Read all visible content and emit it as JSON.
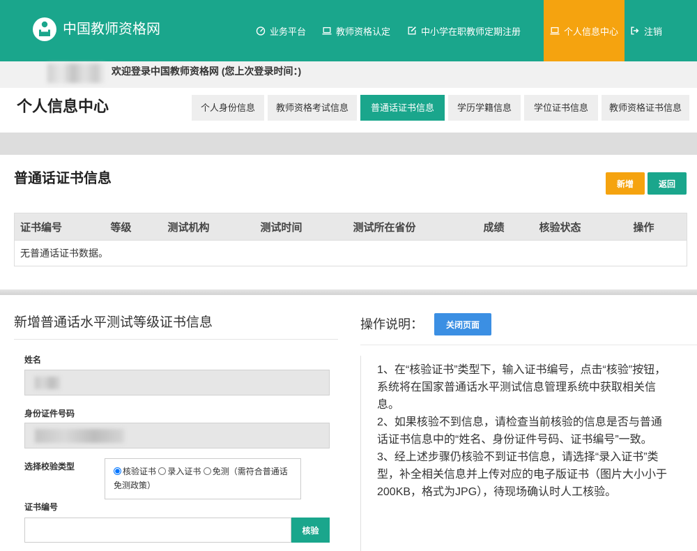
{
  "colors": {
    "primary": "#1aa68c",
    "accent": "#f5a30f",
    "info": "#3b8fe3"
  },
  "header": {
    "logo_icon": "teacher-logo-icon",
    "site_title": "中国教师资格网",
    "nav": [
      {
        "label": "业务平台",
        "icon": "dashboard-icon",
        "active": false
      },
      {
        "label": "教师资格认定",
        "icon": "monitor-icon",
        "active": false
      },
      {
        "label": "中小学在职教师定期注册",
        "icon": "edit-icon",
        "active": false
      },
      {
        "label": "个人信息中心",
        "icon": "monitor-icon",
        "active": true
      },
      {
        "label": "注销",
        "icon": "logout-icon",
        "active": false
      }
    ]
  },
  "welcome": {
    "text": "欢迎登录中国教师资格网 (您上次登录时间：)"
  },
  "page": {
    "title": "个人信息中心"
  },
  "tabs": [
    {
      "label": "个人身份信息",
      "active": false
    },
    {
      "label": "教师资格考试信息",
      "active": false
    },
    {
      "label": "普通话证书信息",
      "active": true
    },
    {
      "label": "学历学籍信息",
      "active": false
    },
    {
      "label": "学位证书信息",
      "active": false
    },
    {
      "label": "教师资格证书信息",
      "active": false
    }
  ],
  "certificate_panel": {
    "title": "普通话证书信息",
    "add_label": "新增",
    "back_label": "返回",
    "columns": [
      "证书编号",
      "等级",
      "测试机构",
      "测试时间",
      "测试所在省份",
      "成绩",
      "核验状态",
      "操作"
    ],
    "empty_text": "无普通话证书数据。"
  },
  "form": {
    "title": "新增普通话水平测试等级证书信息",
    "name_label": "姓名",
    "id_label": "身份证件号码",
    "verify_type": {
      "label": "选择校验类型",
      "options": [
        {
          "label": "核验证书",
          "checked": true
        },
        {
          "label": "录入证书",
          "checked": false
        },
        {
          "label": "免测（需符合普通话免测政策）",
          "checked": false
        }
      ]
    },
    "cert_number": {
      "label": "证书编号",
      "verify_label": "核验"
    }
  },
  "instructions": {
    "title": "操作说明：",
    "close_label": "关闭页面",
    "items": [
      "1、在“核验证书”类型下，输入证书编号，点击“核验”按钮，系统将在国家普通话水平测试信息管理系统中获取相关信息。",
      "2、如果核验不到信息，请检查当前核验的信息是否与普通话证书信息中的“姓名、身份证件号码、证书编号”一致。",
      "3、经上述步骤仍核验不到证书信息，请选择“录入证书”类型，补全相关信息并上传对应的电子版证书（图片大小小于200KB，格式为JPG），待现场确认时人工核验。"
    ]
  }
}
